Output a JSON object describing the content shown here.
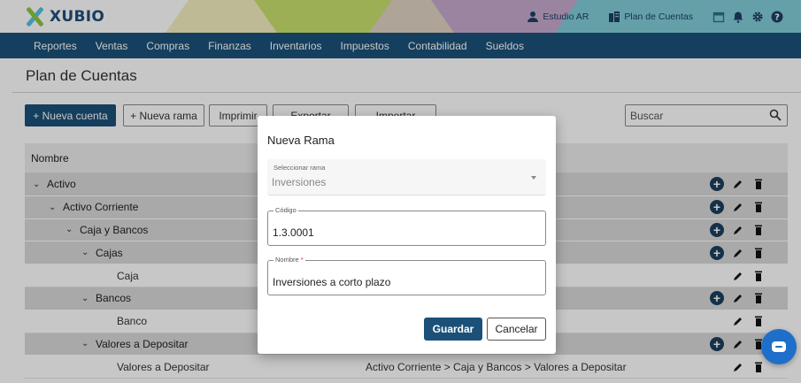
{
  "brand": {
    "logo_text": "XUBIO",
    "logo_colors": [
      "#55c3e8",
      "#8cc63f"
    ]
  },
  "header_bands": [
    "#f4efbf",
    "#c9e06c",
    "#dfd2c2",
    "#c7a9ce",
    "#82cdd8"
  ],
  "topbar": {
    "studio_label": "Estudio AR",
    "accounts_label": "Plan de Cuentas"
  },
  "nav": {
    "items": [
      "Reportes",
      "Ventas",
      "Compras",
      "Finanzas",
      "Inventarios",
      "Impuestos",
      "Contabilidad",
      "Sueldos"
    ]
  },
  "page": {
    "title": "Plan de Cuentas"
  },
  "toolbar": {
    "new_account": "+ Nueva cuenta",
    "new_branch": "+ Nueva rama",
    "print": "Imprimir",
    "export": "Exportar",
    "import": "Importar",
    "search_placeholder": "Buscar"
  },
  "table": {
    "header": "Nombre",
    "rows": [
      {
        "name": "Activo",
        "type": "parent",
        "path": ""
      },
      {
        "name": "Activo Corriente",
        "type": "parent",
        "path": ""
      },
      {
        "name": "Caja y Bancos",
        "type": "parent",
        "path": ""
      },
      {
        "name": "Cajas",
        "type": "parent",
        "path": ""
      },
      {
        "name": "Caja",
        "type": "leaf",
        "path": ""
      },
      {
        "name": "Bancos",
        "type": "parent",
        "path": ""
      },
      {
        "name": "Banco",
        "type": "leaf",
        "path": ""
      },
      {
        "name": "Valores a Depositar",
        "type": "parent",
        "path": ""
      },
      {
        "name": "Valores a Depositar",
        "type": "leaf",
        "path": "Activo Corriente > Caja y Bancos > Valores a Depositar"
      }
    ]
  },
  "modal": {
    "title": "Nueva Rama",
    "select_label": "Seleccionar rama",
    "select_value": "Inversiones",
    "code_label": "Código",
    "code_value": "1.3.0001",
    "name_label": "Nombre",
    "name_required_mark": "*",
    "name_value": "Inversiones a corto plazo",
    "save_label": "Guardar",
    "cancel_label": "Cancelar"
  },
  "colors": {
    "primary": "#1b5179",
    "chat": "#1e6fc9"
  }
}
